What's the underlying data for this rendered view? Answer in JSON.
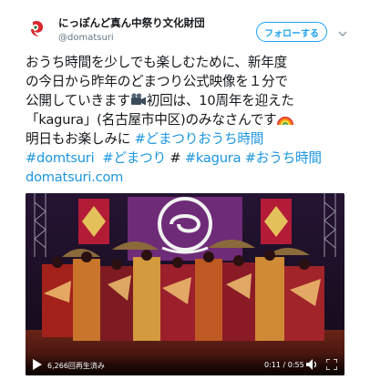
{
  "account": {
    "name": "にっぽんど真ん中祭り文化財団",
    "handle": "@domatsuri",
    "follow_label": "フォローする"
  },
  "tweet": {
    "line1": "おうち時間を少しでも楽しむために、新年度",
    "line2": "の今日から昨年のどまつり公式映像を１分で",
    "line3a": "公開していきます",
    "line3b": "初回は、10周年を迎えた",
    "line4": "「kagura」(名古屋市中区)のみなさんです",
    "line5a": "明日もお楽しみに ",
    "line5b": "#どまつりおうち時間",
    "line6a": "#domtsuri",
    "line6b": "#どまつり",
    "line6c": "#",
    "line6d": "#kagura",
    "line6e": "#おうち時間",
    "line7": "domatsuri.com"
  },
  "video": {
    "views": "6,266回再生済み",
    "time": "0:11 / 0:55"
  },
  "icons": {
    "avatar": "domatsuri-logo-icon",
    "caret": "chevron-down-icon",
    "camera": "movie-camera-icon",
    "rainbow": "rainbow-icon",
    "play": "play-icon",
    "volume": "volume-icon",
    "fullscreen": "fullscreen-icon"
  },
  "colors": {
    "link": "#1b95e0",
    "follow": "#1da1f2"
  }
}
